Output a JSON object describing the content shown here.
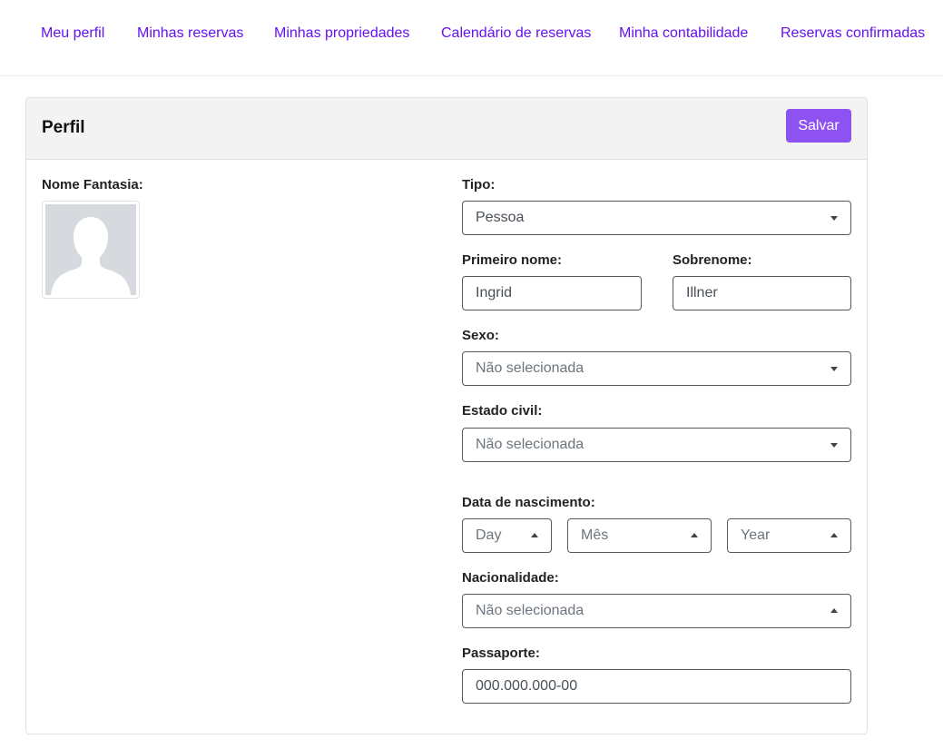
{
  "nav": {
    "items": [
      {
        "label": "Meu perfil"
      },
      {
        "label": "Minhas reservas"
      },
      {
        "label": "Minhas propriedades"
      },
      {
        "label": "Calendário de reservas"
      },
      {
        "label": "Minha contabilidade"
      },
      {
        "label": "Reservas confirmadas"
      }
    ]
  },
  "colors": {
    "accent": "#6610f2",
    "button": "#8e52f0"
  },
  "profile": {
    "title": "Perfil",
    "save_label": "Salvar",
    "fantasy_name_label": "Nome Fantasia:",
    "type_label": "Tipo:",
    "type_value": "Pessoa",
    "first_name_label": "Primeiro nome:",
    "first_name_value": "Ingrid",
    "last_name_label": "Sobrenome:",
    "last_name_value": "Illner",
    "sex_label": "Sexo:",
    "sex_value": "Não selecionada",
    "marital_label": "Estado civil:",
    "marital_value": "Não selecionada",
    "birth_label": "Data de nascimento:",
    "birth_day": "Day",
    "birth_month": "Mês",
    "birth_year": "Year",
    "nationality_label": "Nacionalidade:",
    "nationality_value": "Não selecionada",
    "passport_label": "Passaporte:",
    "passport_value": "000.000.000-00"
  }
}
